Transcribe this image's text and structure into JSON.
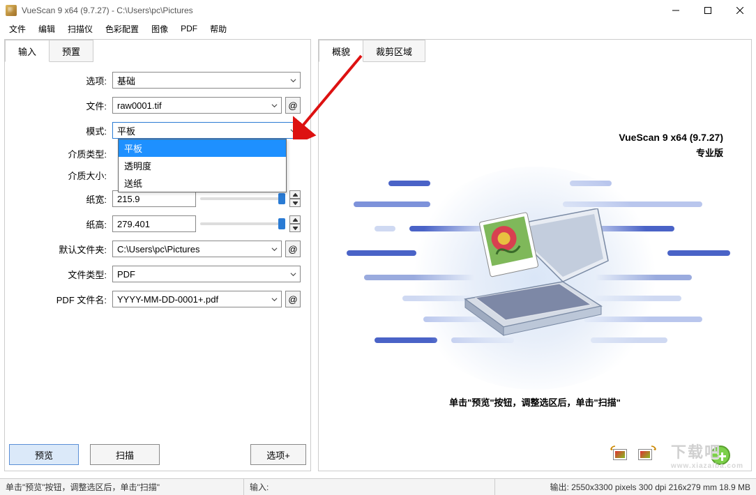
{
  "window": {
    "title": "VueScan 9 x64 (9.7.27) - C:\\Users\\pc\\Pictures"
  },
  "menu": {
    "file": "文件",
    "edit": "编辑",
    "scanner": "扫描仪",
    "color": "色彩配置",
    "image": "图像",
    "pdf": "PDF",
    "help": "帮助"
  },
  "left": {
    "tab_input": "输入",
    "tab_preset": "预置",
    "labels": {
      "options": "选项:",
      "file": "文件:",
      "mode": "模式:",
      "media_type": "介质类型:",
      "media_size": "介质大小:",
      "paper_w": "纸宽:",
      "paper_h": "纸高:",
      "default_folder": "默认文件夹:",
      "file_type": "文件类型:",
      "pdf_filename": "PDF 文件名:"
    },
    "values": {
      "options": "基础",
      "file": "raw0001.tif",
      "mode": "平板",
      "paper_w": "215.9",
      "paper_h": "279.401",
      "default_folder": "C:\\Users\\pc\\Pictures",
      "file_type": "PDF",
      "pdf_filename": "YYYY-MM-DD-0001+.pdf"
    },
    "mode_options": {
      "opt1": "平板",
      "opt2": "透明度",
      "opt3": "送纸"
    },
    "at": "@"
  },
  "buttons": {
    "preview": "预览",
    "scan": "扫描",
    "options_plus": "选项+"
  },
  "right": {
    "tab_preview": "概貌",
    "tab_crop": "裁剪区域",
    "title": "VueScan 9 x64 (9.7.27)",
    "subtitle": "专业版",
    "instruction": "单击\"预览\"按钮，调整选区后，单击\"扫描\""
  },
  "status": {
    "hint": "单击\"预览\"按钮，调整选区后，单击\"扫描\"",
    "input_label": "输入:",
    "output": "输出: 2550x3300 pixels 300 dpi 216x279 mm 18.9 MB"
  },
  "watermark": {
    "big": "下载吧",
    "small": "www.xiazaiba.com"
  }
}
